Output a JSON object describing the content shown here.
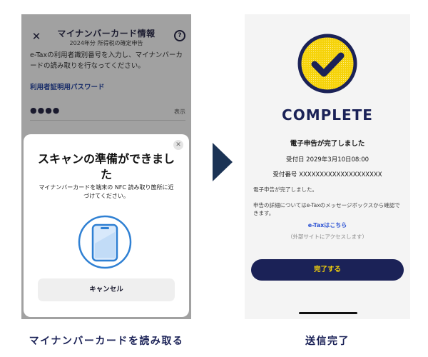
{
  "left_screen": {
    "title": "マイナンバーカード情報",
    "subtitle": "2024年分 所得税の確定申告",
    "close_icon": "close-icon",
    "help_icon": "help-icon",
    "close_glyph": "✕",
    "help_glyph": "?",
    "instruction": "e-Taxの利用者識別番号を入力し、マイナンバーカードの読み取りを行なってください。",
    "password_label": "利用者証明用パスワード",
    "password_value": "●●●●",
    "show_label": "表示",
    "nfc_sheet": {
      "close_glyph": "✕",
      "title": "スキャンの準備ができました",
      "instruction": "マイナンバーカードを端末の NFC 読み取り箇所に近づけてください。",
      "icon": "phone-nfc-icon",
      "cancel_label": "キャンセル"
    }
  },
  "right_screen": {
    "heading": "COMPLETE",
    "done_title": "電子申告が完了しました",
    "receipt_date": "受付日 2029年3月10日08:00",
    "receipt_number": "受付番号 XXXXXXXXXXXXXXXXXXXX",
    "paragraph1": "電子申告が完了しました。",
    "paragraph2": "申告の詳細についてはe-Taxのメッセージボックスから確認できます。",
    "link_label": "e-Taxはこちら",
    "link_note": "（外部サイトにアクセスします）",
    "finish_label": "完了する",
    "check_icon": "check-circle-icon"
  },
  "captions": {
    "left": "マイナンバーカードを読み取る",
    "right": "送信完了"
  },
  "colors": {
    "navy": "#1b2257",
    "yellow": "#f6d30a",
    "link_blue": "#2a51d3",
    "nfc_blue": "#2f80d3",
    "dim_overlay": "#a1a1a1"
  }
}
